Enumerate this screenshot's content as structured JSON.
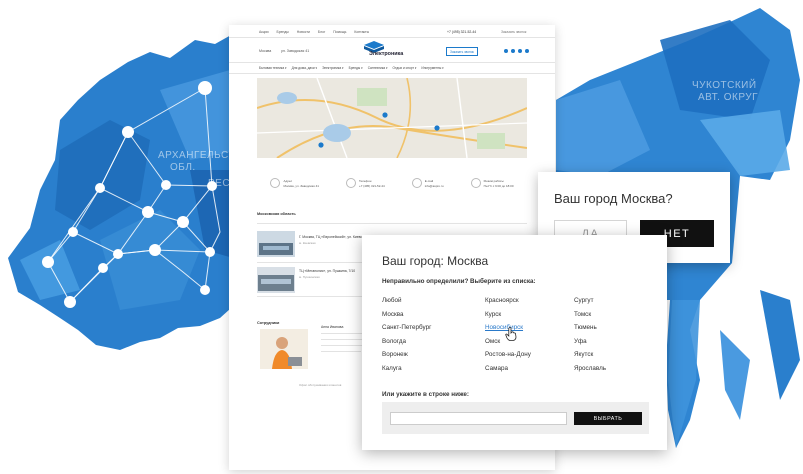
{
  "map": {
    "region_labels": [
      "АРХАНГЕЛЬСКАЯ",
      "ОБЛ.",
      "РЕСП",
      "ЧУКОТСКИЙ",
      "АВТ. ОКРУГ"
    ]
  },
  "site": {
    "top_nav": [
      "Акции",
      "Бренды",
      "Новости",
      "Блог",
      "Помощь",
      "Контакты"
    ],
    "phone": "+7 (495) 321-52-44",
    "callback": "Заказать звонок",
    "logo_text": "Электроника",
    "city": "Москва",
    "address": "ул. Заводская 41",
    "order_button": "Заказать звонок",
    "menu": [
      "Бытовая техника ▾",
      "Для дома, дачи ▾",
      "Электроника ▾",
      "Бренды ▾",
      "Сантехника ▾",
      "Отдых и спорт ▾",
      "Инструменты ▾"
    ],
    "contacts": [
      [
        "Адрес",
        "Москва, ул. Заводская 41"
      ],
      [
        "Телефон",
        "+7 (495) 321-52-44"
      ],
      [
        "E-mail",
        "info@aspro.ru"
      ],
      [
        "Режим работы",
        "Пн-Пт с 9:00 до 18:00"
      ]
    ],
    "section_title": "Московская область",
    "stores": [
      [
        "Г. Москва, ТЦ «Европейский», ул. Киевская, 2",
        "м. Киевская"
      ],
      [
        "ТЦ «Мегаполис», ул. Пушкина, 7/10",
        "м. Пушкинская"
      ]
    ],
    "staff_title": "Сотрудники",
    "staff_name": "Анна Иванова",
    "footer_note": "Офис обслуживания клиентов"
  },
  "confirm": {
    "title": "Ваш город Москва?",
    "yes": "ДА",
    "no": "НЕТ"
  },
  "city_select": {
    "title": "Ваш город: Москва",
    "question": "Неправильно определили? Выберите из списка:",
    "columns": [
      [
        "Любой",
        "Москва",
        "Санкт-Петербург",
        "Вологда",
        "Воронеж",
        "Калуга"
      ],
      [
        "Красноярск",
        "Курск",
        "Новосибирск",
        "Омск",
        "Ростов-на-Дону",
        "Самара"
      ],
      [
        "Сургут",
        "Томск",
        "Тюмень",
        "Уфа",
        "Якутск",
        "Ярославль"
      ]
    ],
    "highlighted": "Новосибирск",
    "manual_label": "Или укажите в строке ниже:",
    "input_value": "",
    "select_button": "ВЫБРАТЬ"
  },
  "colors": {
    "map_dark": "#1f6fbf",
    "map_mid": "#3d8fd6",
    "map_light": "#5aa7e6",
    "link": "#2a79c9",
    "button_dark": "#111111"
  }
}
